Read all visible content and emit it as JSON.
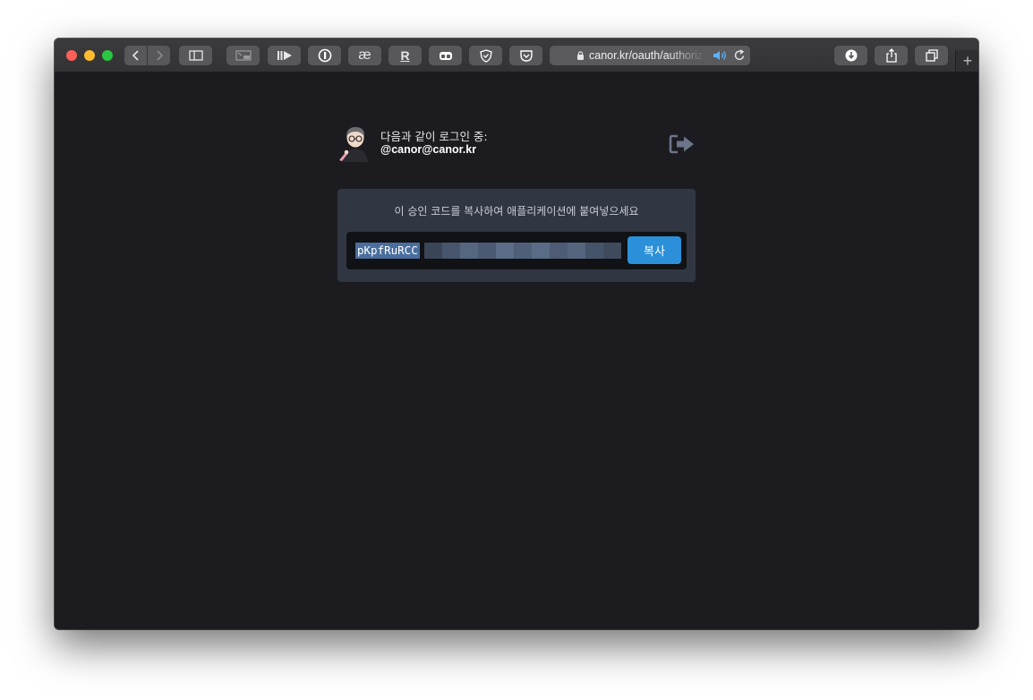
{
  "browser": {
    "url_text": "canor.kr/oauth/authoriz",
    "toolbar_icons": [
      "sidebar-icon",
      "picture-in-picture-icon",
      "reader-icon",
      "1password-icon",
      "ae-extension-icon",
      "r-extension-icon",
      "glasses-icon",
      "shield-icon",
      "pocket-icon",
      "download-icon",
      "share-icon",
      "tabs-icon"
    ],
    "new_tab_label": "+"
  },
  "auth": {
    "login_label": "다음과 같이 로그인 중:",
    "account": "@canor@canor.kr",
    "instruction": "이 승인 코드를 복사하여 애플리케이션에 붙여넣으세요",
    "code_visible": "pKpfRuRCC",
    "copy_label": "복사"
  },
  "colors": {
    "background": "#1b1b20",
    "panel": "#313643",
    "accent": "#2b90d9",
    "selection": "#4a6e9e"
  }
}
